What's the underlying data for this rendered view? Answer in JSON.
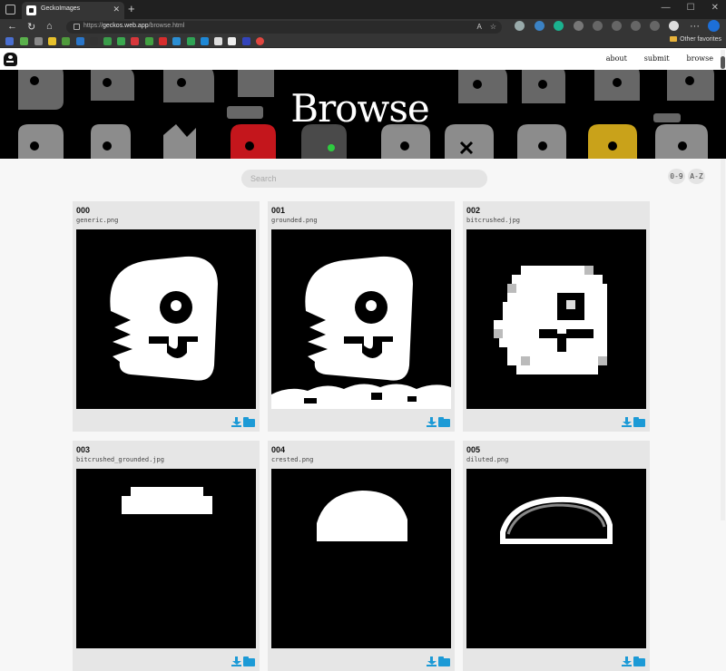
{
  "browser": {
    "tab_title": "GeckoImages",
    "url_prefix": "https://",
    "url_host": "geckos.web.app",
    "url_path": "/browse.html",
    "other_favorites": "Other favorites"
  },
  "nav": {
    "links": [
      "about",
      "submit",
      "browse"
    ]
  },
  "hero": {
    "title": "Browse"
  },
  "search": {
    "placeholder": "Search"
  },
  "sort": {
    "numeric": "0-9",
    "alpha": "A-Z"
  },
  "cards": [
    {
      "id": "000",
      "filename": "generic.png",
      "variant": "generic"
    },
    {
      "id": "001",
      "filename": "grounded.png",
      "variant": "grounded"
    },
    {
      "id": "002",
      "filename": "bitcrushed.jpg",
      "variant": "bitcrushed"
    },
    {
      "id": "003",
      "filename": "bitcrushed_grounded.jpg",
      "variant": "bitcrushed_grounded"
    },
    {
      "id": "004",
      "filename": "crested.png",
      "variant": "crested"
    },
    {
      "id": "005",
      "filename": "diluted.png",
      "variant": "diluted"
    }
  ],
  "colors": {
    "accent": "#1c9ad6",
    "card_bg": "#e6e6e6",
    "page_bg": "#f7f7f7"
  }
}
